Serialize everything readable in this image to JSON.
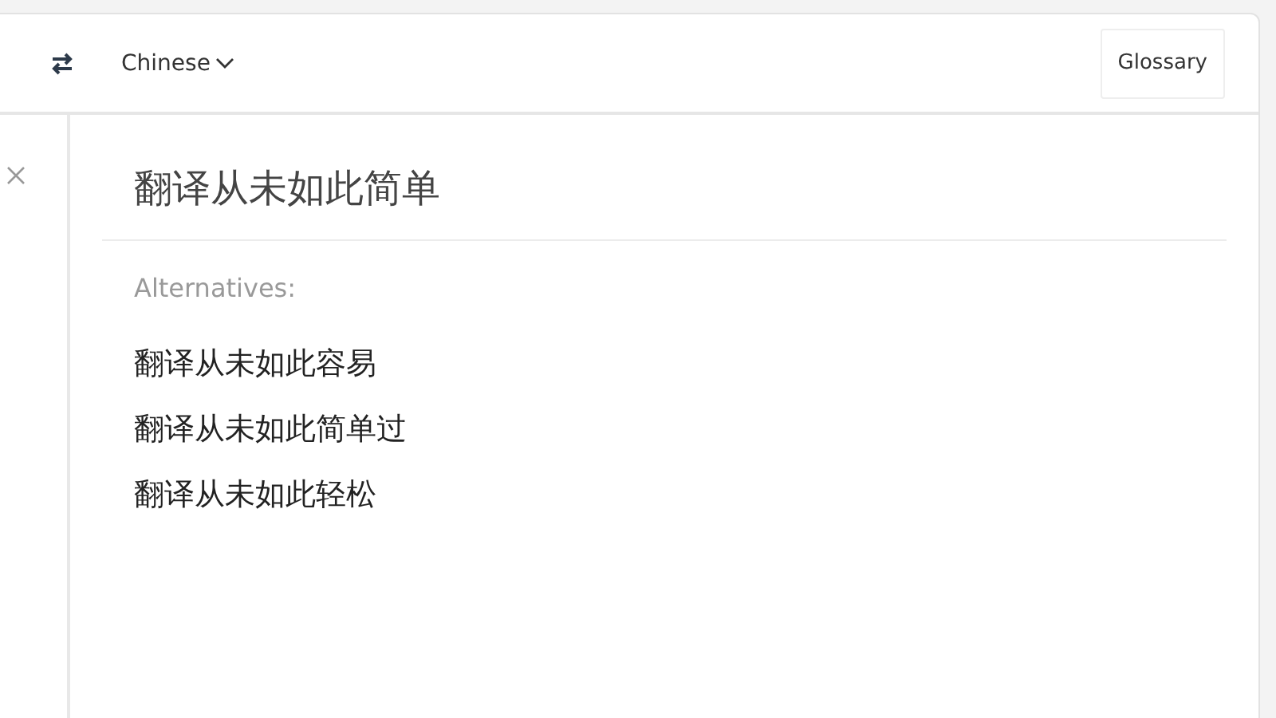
{
  "toolbar": {
    "target_language": "Chinese",
    "glossary_button": "Glossary"
  },
  "translation": {
    "text": "翻译从未如此简单",
    "alternatives_label": "Alternatives:",
    "alternatives": [
      "翻译从未如此容易",
      "翻译从未如此简单过",
      "翻译从未如此轻松"
    ]
  }
}
